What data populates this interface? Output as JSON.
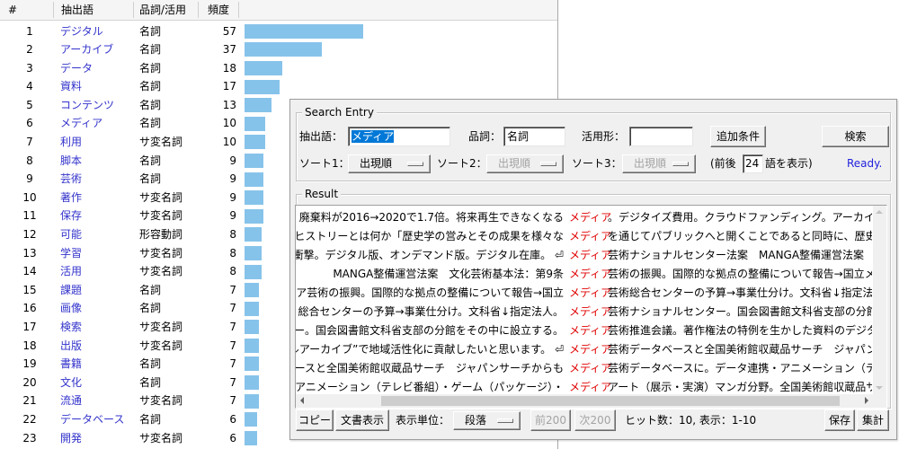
{
  "word_table": {
    "headers": {
      "num": "#",
      "word": "抽出語",
      "pos": "品詞/活用",
      "freq": "頻度"
    },
    "word_color": "#3333cc",
    "bar_color": "#86c3ea",
    "rows": [
      {
        "num": 1,
        "word": "デジタル",
        "pos": "名詞",
        "freq": 57
      },
      {
        "num": 2,
        "word": "アーカイブ",
        "pos": "名詞",
        "freq": 37
      },
      {
        "num": 3,
        "word": "データ",
        "pos": "名詞",
        "freq": 18
      },
      {
        "num": 4,
        "word": "資料",
        "pos": "名詞",
        "freq": 17
      },
      {
        "num": 5,
        "word": "コンテンツ",
        "pos": "名詞",
        "freq": 13
      },
      {
        "num": 6,
        "word": "メディア",
        "pos": "名詞",
        "freq": 10
      },
      {
        "num": 7,
        "word": "利用",
        "pos": "サ変名詞",
        "freq": 10
      },
      {
        "num": 8,
        "word": "脚本",
        "pos": "名詞",
        "freq": 9
      },
      {
        "num": 9,
        "word": "芸術",
        "pos": "名詞",
        "freq": 9
      },
      {
        "num": 10,
        "word": "著作",
        "pos": "サ変名詞",
        "freq": 9
      },
      {
        "num": 11,
        "word": "保存",
        "pos": "サ変名詞",
        "freq": 9
      },
      {
        "num": 12,
        "word": "可能",
        "pos": "形容動詞",
        "freq": 8
      },
      {
        "num": 13,
        "word": "学習",
        "pos": "サ変名詞",
        "freq": 8
      },
      {
        "num": 14,
        "word": "活用",
        "pos": "サ変名詞",
        "freq": 8
      },
      {
        "num": 15,
        "word": "課題",
        "pos": "名詞",
        "freq": 7
      },
      {
        "num": 16,
        "word": "画像",
        "pos": "名詞",
        "freq": 7
      },
      {
        "num": 17,
        "word": "検索",
        "pos": "サ変名詞",
        "freq": 7
      },
      {
        "num": 18,
        "word": "出版",
        "pos": "サ変名詞",
        "freq": 7
      },
      {
        "num": 19,
        "word": "書籍",
        "pos": "名詞",
        "freq": 7
      },
      {
        "num": 20,
        "word": "文化",
        "pos": "名詞",
        "freq": 7
      },
      {
        "num": 21,
        "word": "流通",
        "pos": "サ変名詞",
        "freq": 7
      },
      {
        "num": 22,
        "word": "データベース",
        "pos": "名詞",
        "freq": 6
      },
      {
        "num": 23,
        "word": "開発",
        "pos": "サ変名詞",
        "freq": 6
      }
    ]
  },
  "search_dialog": {
    "search_entry": {
      "group_label": "Search Entry",
      "word_label": "抽出語：",
      "word_value": "メディア",
      "selection_color": "#0078d7",
      "pos_label": "品詞：",
      "pos_value": "名詞",
      "conj_label": "活用形：",
      "conj_value": "",
      "add_condition_button": "追加条件",
      "search_button": "検索",
      "sort1_label": "ソート1：",
      "sort1_value": "出現順",
      "sort2_label": "ソート2：",
      "sort2_value": "出現順",
      "sort3_label": "ソート3：",
      "sort3_value": "出現順",
      "context_prefix": "(前後",
      "context_value": "24",
      "context_suffix": "語を表示)",
      "status": "Ready.",
      "status_color": "#2222dd"
    },
    "result": {
      "group_label": "Result",
      "keyword_color": "#e00000",
      "lines": [
        {
          "left": "廃棄料が2016→2020で1.7倍。将来再生できなくなる",
          "keyword": "メディア",
          "right": "。デジタイズ費用。クラウドファンディング。アーカイブ費用。コ"
        },
        {
          "left": "ック・ヒストリーとは何か「歴史学の営みとその成果を様々な",
          "keyword": "メディア",
          "right": "を通じてパブリックへと開くことであると同時に、歴史研究者か"
        },
        {
          "left": "版に衝撃。デジタル版、オンデマンド版。デジタル在庫。 ⏎",
          "keyword": "メディア",
          "right": "芸術ナショナルセンター法案　MANGA整備運営法案　文化"
        },
        {
          "left": "MANGA整備運営法案　文化芸術基本法：第9条",
          "keyword": "メディア",
          "right": "芸術の振興。国際的な拠点の整備について報告→国立メ"
        },
        {
          "left": "ア芸術の振興。国際的な拠点の整備について報告→国立",
          "keyword": "メディア",
          "right": "芸術総合センターの予算→事業仕分け。文科省↓指定法"
        },
        {
          "left": "総合センターの予算→事業仕分け。文科省↓指定法人。",
          "keyword": "メディア",
          "right": "芸術ナショナルセンター。国会図書館文科省支部の分館を"
        },
        {
          "left": "ー。国会図書館文科省支部の分館をその中に設立する。",
          "keyword": "メディア",
          "right": "芸術推進会議。著作権法の特例を生かした資料のデジタル"
        },
        {
          "left": "タルアーカイブ”で地域活性化に貢献したいと思います。 ⏎",
          "keyword": "メディア",
          "right": "芸術データベースと全国美術館収蔵品サーチ　ジャパンサー"
        },
        {
          "left": "タベースと全国美術館収蔵品サーチ　ジャパンサーチからも",
          "keyword": "メディア",
          "right": "芸術データベースに。データ連携・アニメーション（テレビ番"
        },
        {
          "left": "連携・アニメーション（テレビ番組）・ゲーム（パッケージ）・",
          "keyword": "メディア",
          "right": "アート（展示・実演）マンガ分野。全国美術館収蔵品サーチ"
        }
      ]
    },
    "footer": {
      "copy_button": "コピー",
      "doc_view_button": "文書表示",
      "unit_label": "表示単位：",
      "unit_value": "段落",
      "prev_button": "前200",
      "next_button": "次200",
      "hits_text": "ヒット数：10, 表示：1-10",
      "save_button": "保存",
      "summary_button": "集計"
    },
    "icons": {
      "scroll_up": "scroll-up-icon",
      "scroll_down": "scroll-down-icon",
      "scroll_left": "scroll-left-icon",
      "scroll_right": "scroll-right-icon",
      "dropdown": "dropdown-indicator-icon"
    }
  }
}
